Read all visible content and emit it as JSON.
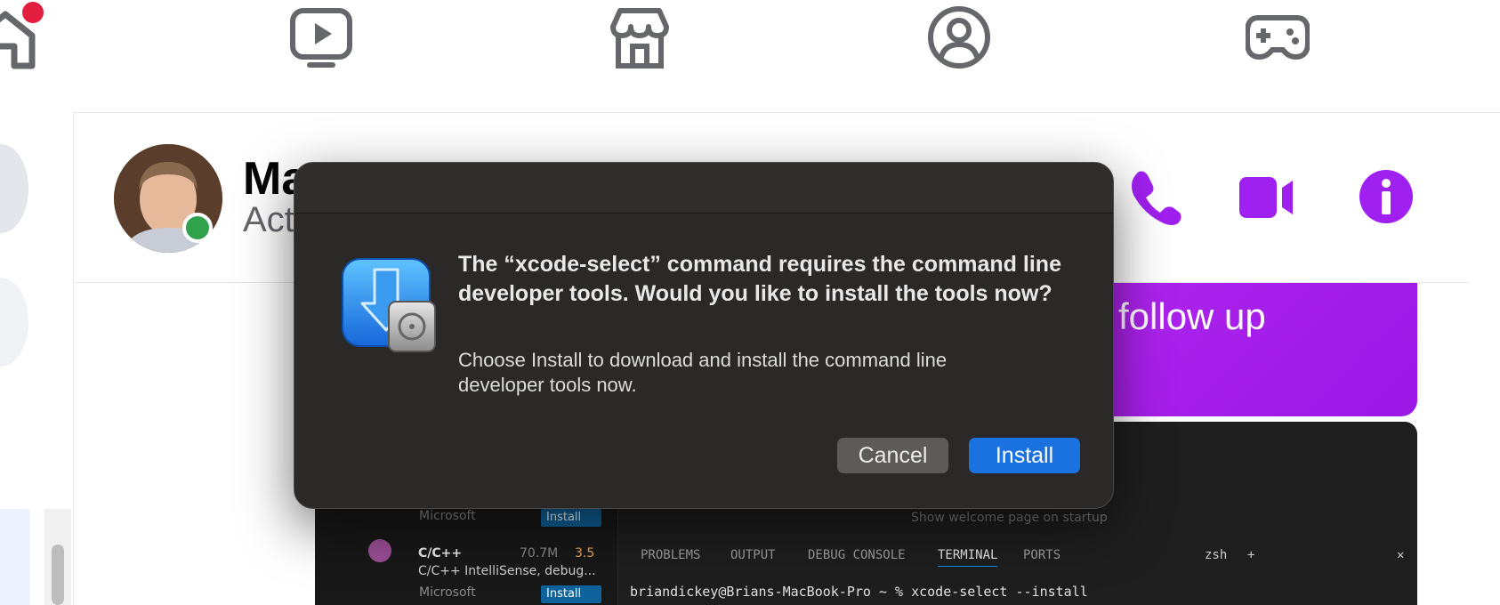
{
  "topnav": {
    "icons": [
      "home-icon",
      "video-icon",
      "marketplace-icon",
      "groups-icon",
      "gaming-icon"
    ]
  },
  "chat": {
    "contact_name": "Ma",
    "contact_status": "Act",
    "header_icons": [
      "phone-icon",
      "video-call-icon",
      "info-icon"
    ],
    "accent_color": "#a020f0"
  },
  "bubble": {
    "text": "follow up"
  },
  "screenshot": {
    "extensions": [
      {
        "publisher": "Microsoft",
        "install_label": "Install"
      },
      {
        "name": "C/C++",
        "downloads": "70.7M",
        "rating": "3.5",
        "description": "C/C++ IntelliSense, debug...",
        "publisher": "Microsoft",
        "install_label": "Install"
      }
    ],
    "welcome_text": "Show welcome page on startup",
    "panel_tabs": [
      "PROBLEMS",
      "OUTPUT",
      "DEBUG CONSOLE",
      "TERMINAL",
      "PORTS"
    ],
    "shell": "zsh",
    "terminal_line": "briandickey@Brians-MacBook-Pro ~ % xcode-select --install"
  },
  "dialog": {
    "title": "The “xcode-select” command requires the command line developer tools. Would you like to install the tools now?",
    "message": "Choose Install to download and install the command line developer tools now.",
    "cancel_label": "Cancel",
    "install_label": "Install"
  }
}
